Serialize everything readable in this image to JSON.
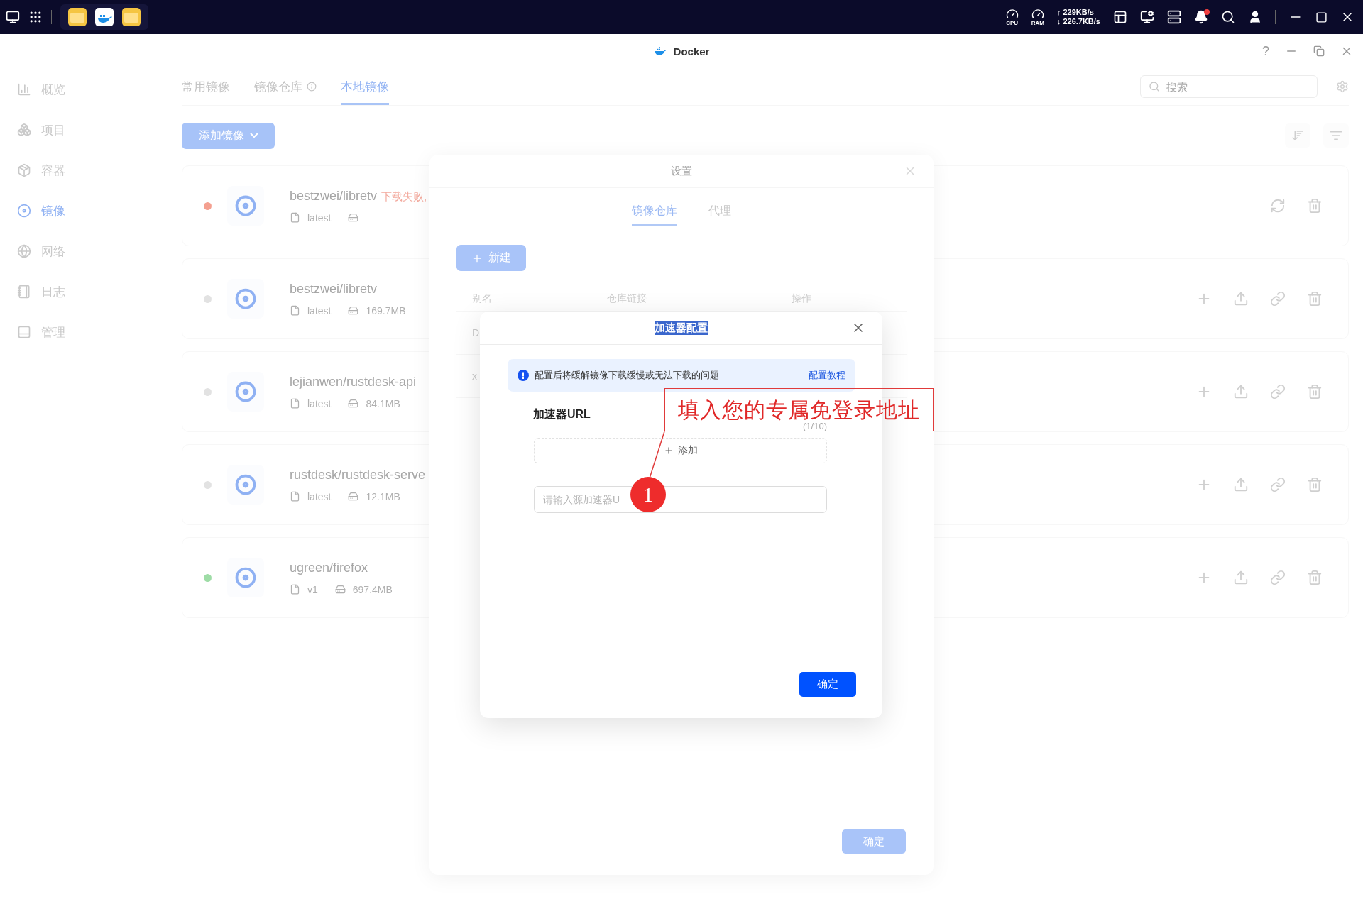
{
  "taskbar": {
    "apps": [
      {
        "kind": "folder"
      },
      {
        "kind": "docker"
      },
      {
        "kind": "folder"
      }
    ],
    "cpu_label": "CPU",
    "ram_label": "RAM",
    "upload": "↑ 229KB/s",
    "download": "↓ 226.7KB/s",
    "notifications_unread": true
  },
  "window": {
    "title": "Docker",
    "help": "?"
  },
  "sidebar": {
    "items": [
      {
        "label": "概览",
        "kind": "overview",
        "selected": false
      },
      {
        "label": "项目",
        "kind": "project",
        "selected": false
      },
      {
        "label": "容器",
        "kind": "container",
        "selected": false
      },
      {
        "label": "镜像",
        "kind": "image",
        "selected": true
      },
      {
        "label": "网络",
        "kind": "network",
        "selected": false
      },
      {
        "label": "日志",
        "kind": "log",
        "selected": false
      },
      {
        "label": "管理",
        "kind": "manage",
        "selected": false
      }
    ]
  },
  "tabs": [
    {
      "label": "常用镜像",
      "selected": false,
      "info": false
    },
    {
      "label": "镜像仓库",
      "selected": false,
      "info": true
    },
    {
      "label": "本地镜像",
      "selected": true,
      "info": false
    }
  ],
  "search": {
    "placeholder": "搜索"
  },
  "add_button": "添加镜像",
  "images": [
    {
      "name": "bestzwei/libretv",
      "status": "下载失败,",
      "color": "#f4a090",
      "tag": "latest",
      "kind": "failed"
    },
    {
      "name": "bestzwei/libretv",
      "color": "#e2e2e2",
      "tag": "latest",
      "size": "169.7MB",
      "kind": "ready"
    },
    {
      "name": "lejianwen/rustdesk-api",
      "color": "#e2e2e2",
      "tag": "latest",
      "size": "84.1MB",
      "kind": "ready"
    },
    {
      "name": "rustdesk/rustdesk-serve",
      "color": "#e2e2e2",
      "tag": "latest",
      "size": "12.1MB",
      "kind": "ready"
    },
    {
      "name": "ugreen/firefox",
      "color": "#9edca6",
      "tag": "v1",
      "size": "697.4MB",
      "kind": "ready"
    }
  ],
  "settings": {
    "title": "设置",
    "tabs": [
      {
        "label": "镜像仓库",
        "selected": true
      },
      {
        "label": "代理",
        "selected": false
      }
    ],
    "new_button": "新建",
    "columns": [
      "别名",
      "仓库链接",
      "操作"
    ],
    "rows": [
      "D",
      "x"
    ],
    "confirm": "确定"
  },
  "accelerator": {
    "title": "加速器配置",
    "title_selected": true,
    "notice": "配置后将缓解镜像下载缓慢或无法下载的问题",
    "notice_link": "配置教程",
    "url_label": "加速器URL",
    "count": "(1/10)",
    "add_label": "添加",
    "placeholder": "请输入源加速器U",
    "confirm": "确定"
  },
  "annotation": {
    "text": "填入您的专属免登录地址",
    "number": "1"
  }
}
